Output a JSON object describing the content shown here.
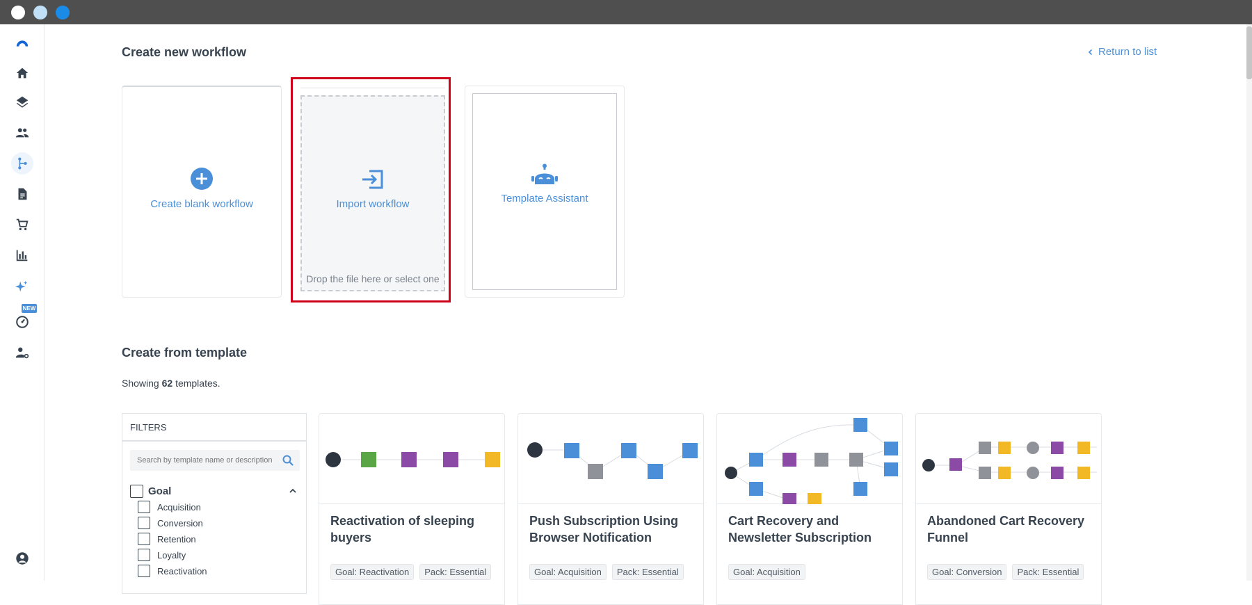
{
  "header": {
    "title": "Create new workflow",
    "return_label": "Return to list"
  },
  "create_options": {
    "blank_label": "Create blank workflow",
    "import_label": "Import workflow",
    "import_sub": "Drop the file here or select one",
    "assistant_label": "Template Assistant"
  },
  "templates": {
    "title": "Create from template",
    "showing_prefix": "Showing",
    "count": "62",
    "showing_suffix": "templates."
  },
  "filters": {
    "heading": "FILTERS",
    "search_placeholder": "Search by template name or description",
    "goal_label": "Goal",
    "goal_options": [
      "Acquisition",
      "Conversion",
      "Retention",
      "Loyalty",
      "Reactivation"
    ]
  },
  "template_cards": [
    {
      "title": "Reactivation of sleeping buyers",
      "tags": [
        "Goal: Reactivation",
        "Pack: Essential"
      ]
    },
    {
      "title": "Push Subscription Using Browser Notification",
      "tags": [
        "Goal: Acquisition",
        "Pack: Essential"
      ]
    },
    {
      "title": "Cart Recovery and Newsletter Subscription",
      "tags": [
        "Goal: Acquisition"
      ]
    },
    {
      "title": "Abandoned Cart Recovery Funnel",
      "tags": [
        "Goal: Conversion",
        "Pack: Essential"
      ]
    }
  ],
  "sidebar": {
    "new_badge": "NEW",
    "icons": [
      "logo-icon",
      "home-icon",
      "layers-icon",
      "contacts-icon",
      "workflow-icon",
      "document-icon",
      "cart-icon",
      "chart-icon",
      "ai-sparkle-icon",
      "dashboard-icon",
      "user-settings-icon",
      "profile-icon"
    ]
  },
  "colors": {
    "accent": "#4a8fd8",
    "highlight": "#d0021b",
    "titlebar": "#4f4f4f"
  }
}
